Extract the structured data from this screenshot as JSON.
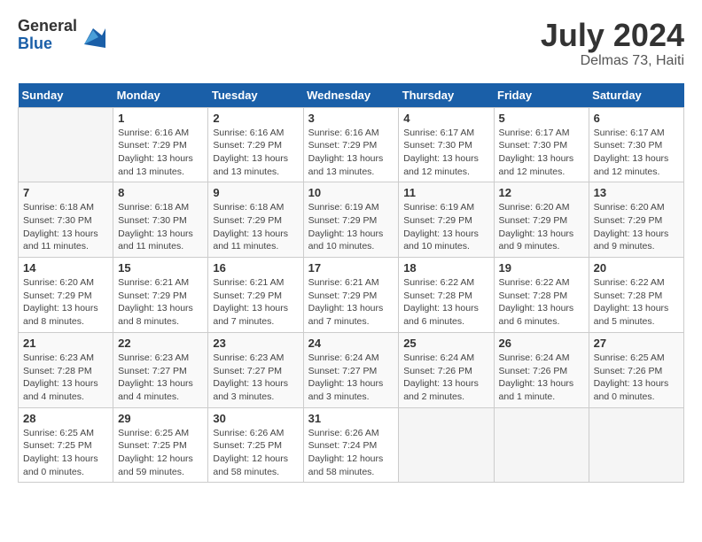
{
  "logo": {
    "general": "General",
    "blue": "Blue"
  },
  "title": {
    "month_year": "July 2024",
    "location": "Delmas 73, Haiti"
  },
  "calendar": {
    "headers": [
      "Sunday",
      "Monday",
      "Tuesday",
      "Wednesday",
      "Thursday",
      "Friday",
      "Saturday"
    ],
    "weeks": [
      [
        {
          "day": "",
          "sunrise": "",
          "sunset": "",
          "daylight": ""
        },
        {
          "day": "1",
          "sunrise": "Sunrise: 6:16 AM",
          "sunset": "Sunset: 7:29 PM",
          "daylight": "Daylight: 13 hours and 13 minutes."
        },
        {
          "day": "2",
          "sunrise": "Sunrise: 6:16 AM",
          "sunset": "Sunset: 7:29 PM",
          "daylight": "Daylight: 13 hours and 13 minutes."
        },
        {
          "day": "3",
          "sunrise": "Sunrise: 6:16 AM",
          "sunset": "Sunset: 7:29 PM",
          "daylight": "Daylight: 13 hours and 13 minutes."
        },
        {
          "day": "4",
          "sunrise": "Sunrise: 6:17 AM",
          "sunset": "Sunset: 7:30 PM",
          "daylight": "Daylight: 13 hours and 12 minutes."
        },
        {
          "day": "5",
          "sunrise": "Sunrise: 6:17 AM",
          "sunset": "Sunset: 7:30 PM",
          "daylight": "Daylight: 13 hours and 12 minutes."
        },
        {
          "day": "6",
          "sunrise": "Sunrise: 6:17 AM",
          "sunset": "Sunset: 7:30 PM",
          "daylight": "Daylight: 13 hours and 12 minutes."
        }
      ],
      [
        {
          "day": "7",
          "sunrise": "Sunrise: 6:18 AM",
          "sunset": "Sunset: 7:30 PM",
          "daylight": "Daylight: 13 hours and 11 minutes."
        },
        {
          "day": "8",
          "sunrise": "Sunrise: 6:18 AM",
          "sunset": "Sunset: 7:30 PM",
          "daylight": "Daylight: 13 hours and 11 minutes."
        },
        {
          "day": "9",
          "sunrise": "Sunrise: 6:18 AM",
          "sunset": "Sunset: 7:29 PM",
          "daylight": "Daylight: 13 hours and 11 minutes."
        },
        {
          "day": "10",
          "sunrise": "Sunrise: 6:19 AM",
          "sunset": "Sunset: 7:29 PM",
          "daylight": "Daylight: 13 hours and 10 minutes."
        },
        {
          "day": "11",
          "sunrise": "Sunrise: 6:19 AM",
          "sunset": "Sunset: 7:29 PM",
          "daylight": "Daylight: 13 hours and 10 minutes."
        },
        {
          "day": "12",
          "sunrise": "Sunrise: 6:20 AM",
          "sunset": "Sunset: 7:29 PM",
          "daylight": "Daylight: 13 hours and 9 minutes."
        },
        {
          "day": "13",
          "sunrise": "Sunrise: 6:20 AM",
          "sunset": "Sunset: 7:29 PM",
          "daylight": "Daylight: 13 hours and 9 minutes."
        }
      ],
      [
        {
          "day": "14",
          "sunrise": "Sunrise: 6:20 AM",
          "sunset": "Sunset: 7:29 PM",
          "daylight": "Daylight: 13 hours and 8 minutes."
        },
        {
          "day": "15",
          "sunrise": "Sunrise: 6:21 AM",
          "sunset": "Sunset: 7:29 PM",
          "daylight": "Daylight: 13 hours and 8 minutes."
        },
        {
          "day": "16",
          "sunrise": "Sunrise: 6:21 AM",
          "sunset": "Sunset: 7:29 PM",
          "daylight": "Daylight: 13 hours and 7 minutes."
        },
        {
          "day": "17",
          "sunrise": "Sunrise: 6:21 AM",
          "sunset": "Sunset: 7:29 PM",
          "daylight": "Daylight: 13 hours and 7 minutes."
        },
        {
          "day": "18",
          "sunrise": "Sunrise: 6:22 AM",
          "sunset": "Sunset: 7:28 PM",
          "daylight": "Daylight: 13 hours and 6 minutes."
        },
        {
          "day": "19",
          "sunrise": "Sunrise: 6:22 AM",
          "sunset": "Sunset: 7:28 PM",
          "daylight": "Daylight: 13 hours and 6 minutes."
        },
        {
          "day": "20",
          "sunrise": "Sunrise: 6:22 AM",
          "sunset": "Sunset: 7:28 PM",
          "daylight": "Daylight: 13 hours and 5 minutes."
        }
      ],
      [
        {
          "day": "21",
          "sunrise": "Sunrise: 6:23 AM",
          "sunset": "Sunset: 7:28 PM",
          "daylight": "Daylight: 13 hours and 4 minutes."
        },
        {
          "day": "22",
          "sunrise": "Sunrise: 6:23 AM",
          "sunset": "Sunset: 7:27 PM",
          "daylight": "Daylight: 13 hours and 4 minutes."
        },
        {
          "day": "23",
          "sunrise": "Sunrise: 6:23 AM",
          "sunset": "Sunset: 7:27 PM",
          "daylight": "Daylight: 13 hours and 3 minutes."
        },
        {
          "day": "24",
          "sunrise": "Sunrise: 6:24 AM",
          "sunset": "Sunset: 7:27 PM",
          "daylight": "Daylight: 13 hours and 3 minutes."
        },
        {
          "day": "25",
          "sunrise": "Sunrise: 6:24 AM",
          "sunset": "Sunset: 7:26 PM",
          "daylight": "Daylight: 13 hours and 2 minutes."
        },
        {
          "day": "26",
          "sunrise": "Sunrise: 6:24 AM",
          "sunset": "Sunset: 7:26 PM",
          "daylight": "Daylight: 13 hours and 1 minute."
        },
        {
          "day": "27",
          "sunrise": "Sunrise: 6:25 AM",
          "sunset": "Sunset: 7:26 PM",
          "daylight": "Daylight: 13 hours and 0 minutes."
        }
      ],
      [
        {
          "day": "28",
          "sunrise": "Sunrise: 6:25 AM",
          "sunset": "Sunset: 7:25 PM",
          "daylight": "Daylight: 13 hours and 0 minutes."
        },
        {
          "day": "29",
          "sunrise": "Sunrise: 6:25 AM",
          "sunset": "Sunset: 7:25 PM",
          "daylight": "Daylight: 12 hours and 59 minutes."
        },
        {
          "day": "30",
          "sunrise": "Sunrise: 6:26 AM",
          "sunset": "Sunset: 7:25 PM",
          "daylight": "Daylight: 12 hours and 58 minutes."
        },
        {
          "day": "31",
          "sunrise": "Sunrise: 6:26 AM",
          "sunset": "Sunset: 7:24 PM",
          "daylight": "Daylight: 12 hours and 58 minutes."
        },
        {
          "day": "",
          "sunrise": "",
          "sunset": "",
          "daylight": ""
        },
        {
          "day": "",
          "sunrise": "",
          "sunset": "",
          "daylight": ""
        },
        {
          "day": "",
          "sunrise": "",
          "sunset": "",
          "daylight": ""
        }
      ]
    ]
  }
}
